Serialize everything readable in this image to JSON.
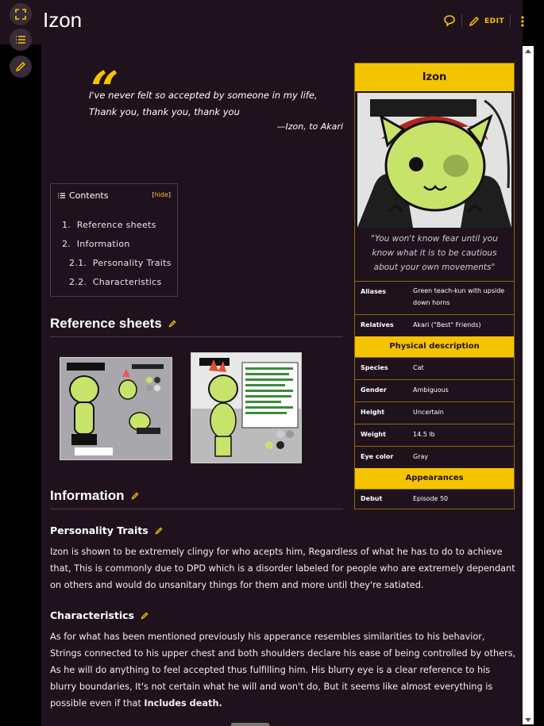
{
  "page": {
    "title": "Izon",
    "edit_label": "EDIT"
  },
  "quote": {
    "text": "I've never felt so accepted by someone in my life, Thank you, thank you, thank you",
    "attribution": "—Izon, to Akari"
  },
  "toc": {
    "heading": "Contents",
    "hide_label": "hide",
    "items": [
      {
        "num": "1.",
        "label": "Reference sheets"
      },
      {
        "num": "2.",
        "label": "Information"
      },
      {
        "num": "2.1.",
        "label": "Personality Traits"
      },
      {
        "num": "2.2.",
        "label": "Characteristics"
      }
    ]
  },
  "sections": {
    "reference_sheets": "Reference sheets",
    "information": "Information",
    "personality_traits": "Personality Traits",
    "characteristics": "Characteristics"
  },
  "body": {
    "personality_text": "Izon is shown to be extremely clingy for who acepts him, Regardless of what he has to do to achieve that, This is commonly due to DPD which is a disorder labeled for people who are extremely dependant on others and would do unsanitary things for them and more until they're satiated.",
    "characteristics_text": "As for what has been mentioned previously his apperance resembles similarities to his behavior, Strings connected to his upper chest and both shoulders declare his ease of being controlled by others, As he will do anything to feel accepted thus fulfilling him. His blurry eye is a clear reference to his blurry boundaries, It's not certain what he will and won't do, But it seems like almost everything is possible even if that",
    "characteristics_bold": "Includes death."
  },
  "infobox": {
    "title": "Izon",
    "caption": "\"You won't know fear until you know what it is to be cautious about your own movements\"",
    "rows_top": [
      {
        "label": "Aliases",
        "value": "Green teach-kun with upside down horns"
      },
      {
        "label": "Relatives",
        "value": "Akari (\"Best\" Friends)"
      }
    ],
    "physical_heading": "Physical description",
    "rows_physical": [
      {
        "label": "Species",
        "value": "Cat"
      },
      {
        "label": "Gender",
        "value": "Ambiguous"
      },
      {
        "label": "Height",
        "value": "Uncertain"
      },
      {
        "label": "Weight",
        "value": "14.5 lb"
      },
      {
        "label": "Eye color",
        "value": "Gray"
      }
    ],
    "appearances_heading": "Appearances",
    "rows_appearances": [
      {
        "label": "Debut",
        "value": "Episode 50"
      }
    ]
  },
  "icons": {
    "expand": "expand-icon",
    "list": "list-icon",
    "edit": "pencil-icon",
    "comment": "comment-icon",
    "menu": "kebab-icon"
  },
  "colors": {
    "accent": "#f5c400",
    "background": "#1f121d",
    "border": "#4b3a48"
  }
}
